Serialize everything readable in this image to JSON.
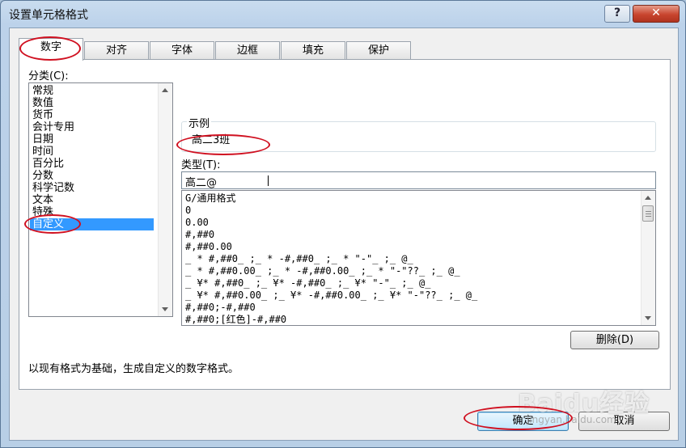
{
  "window": {
    "title": "设置单元格格式",
    "help_label": "?",
    "close_label": "✕"
  },
  "tabs": [
    {
      "label": "数字"
    },
    {
      "label": "对齐"
    },
    {
      "label": "字体"
    },
    {
      "label": "边框"
    },
    {
      "label": "填充"
    },
    {
      "label": "保护"
    }
  ],
  "category": {
    "label": "分类(C):",
    "items": [
      "常规",
      "数值",
      "货币",
      "会计专用",
      "日期",
      "时间",
      "百分比",
      "分数",
      "科学记数",
      "文本",
      "特殊",
      "自定义"
    ],
    "selected": "自定义"
  },
  "sample": {
    "title": "示例",
    "value": "高二3班"
  },
  "type_field": {
    "label": "类型(T):",
    "value": "高二@"
  },
  "format_list": [
    "G/通用格式",
    "0",
    "0.00",
    "#,##0",
    "#,##0.00",
    "_ * #,##0_ ;_ * -#,##0_ ;_ * \"-\"_ ;_ @_",
    "_ * #,##0.00_ ;_ * -#,##0.00_ ;_ * \"-\"??_ ;_ @_",
    "_ ¥* #,##0_ ;_ ¥* -#,##0_ ;_ ¥* \"-\"_ ;_ @_",
    "_ ¥* #,##0.00_ ;_ ¥* -#,##0.00_ ;_ ¥* \"-\"??_ ;_ @_",
    "#,##0;-#,##0",
    "#,##0;[红色]-#,##0"
  ],
  "buttons": {
    "delete": "删除(D)",
    "ok": "确定",
    "cancel": "取消"
  },
  "description": "以现有格式为基础，生成自定义的数字格式。",
  "watermark": {
    "brand": "Baidu经验",
    "url": "jingyan.baidu.com"
  },
  "colors": {
    "selection": "#3399ff",
    "annotation": "#d01020"
  }
}
